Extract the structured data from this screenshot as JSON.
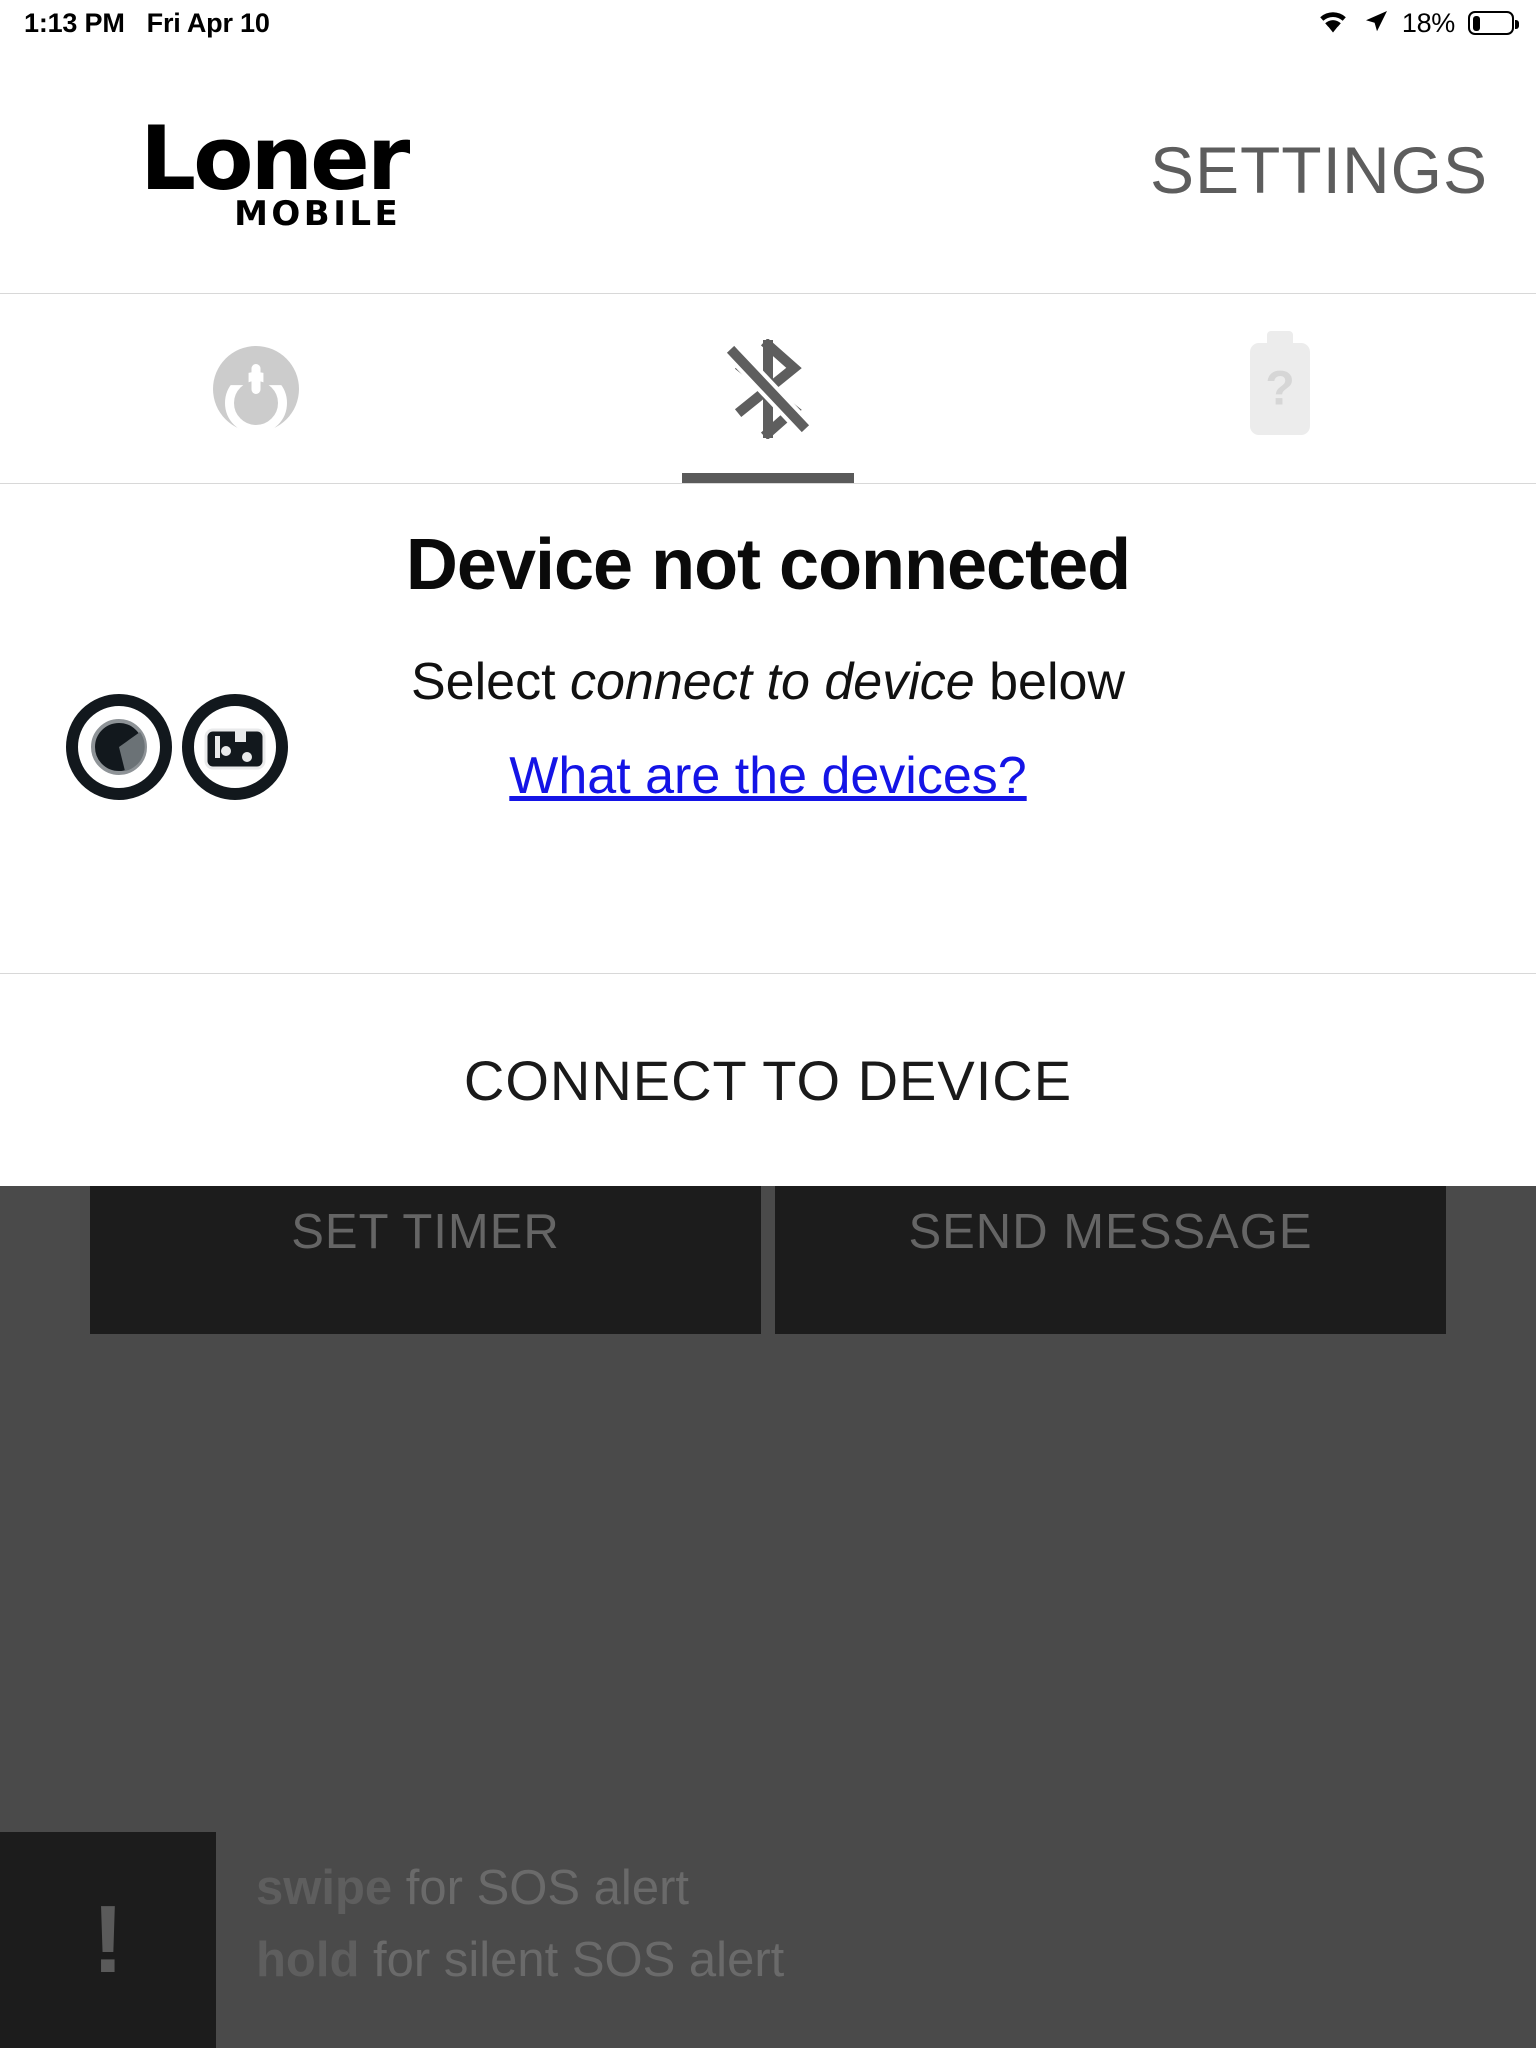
{
  "status_bar": {
    "time": "1:13 PM",
    "date": "Fri Apr 10",
    "battery_percent": "18%",
    "wifi_icon": "wifi-icon",
    "location_icon": "location-arrow-icon",
    "battery_icon": "battery-icon",
    "battery_level": 18
  },
  "header": {
    "logo_main": "Loner",
    "logo_sub": "MOBILE",
    "settings_label": "SETTINGS"
  },
  "tabs": [
    {
      "name": "power",
      "icon": "power-button-icon",
      "active": false
    },
    {
      "name": "bluetooth",
      "icon": "bluetooth-disabled-icon",
      "active": true
    },
    {
      "name": "battery",
      "icon": "battery-unknown-icon",
      "active": false,
      "badge": "?"
    }
  ],
  "content": {
    "headline": "Device not connected",
    "subline_prefix": "Select ",
    "subline_emphasis": "connect to device",
    "subline_suffix": " below",
    "link_label": "What are the devices?",
    "device_icons": [
      "beacon-device-icon",
      "radio-device-icon"
    ]
  },
  "connect": {
    "label": "CONNECT TO DEVICE"
  },
  "actions": {
    "set_timer_label": "SET TIMER",
    "send_message_label": "SEND MESSAGE"
  },
  "sos": {
    "alert_glyph": "!",
    "line1_bold": "swipe",
    "line1_rest": " for SOS alert",
    "line2_bold": "hold",
    "line2_rest": " for silent SOS alert"
  },
  "colors": {
    "link": "#1414e6",
    "dim_overlay": "#4a4a4a",
    "button_dark": "#1c1c1c",
    "tab_active": "#5a5a5a"
  }
}
